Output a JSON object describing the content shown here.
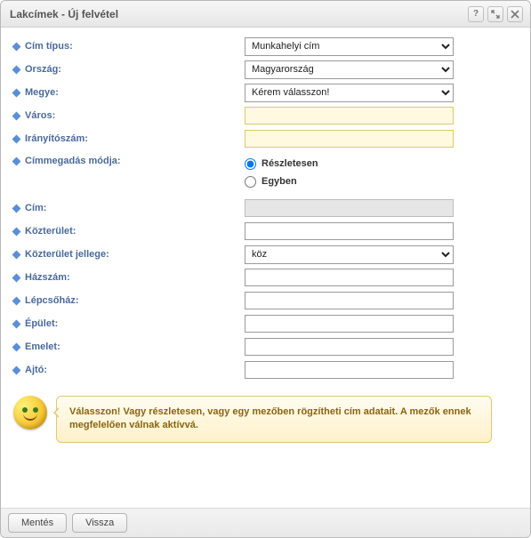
{
  "window": {
    "title": "Lakcímek - Új felvétel"
  },
  "labels": {
    "cimTipus": "Cím típus:",
    "orszag": "Ország:",
    "megye": "Megye:",
    "varos": "Város:",
    "iranyitoszam": "Irányítószám:",
    "cimmegadas": "Címmegadás módja:",
    "cim": "Cím:",
    "kozterulet": "Közterület:",
    "kozteruletJelleg": "Közterület jellege:",
    "hazszam": "Házszám:",
    "lepcsohaz": "Lépcsőház:",
    "epulet": "Épület:",
    "emelet": "Emelet:",
    "ajto": "Ajtó:"
  },
  "values": {
    "cimTipus": "Munkahelyi cím",
    "orszag": "Magyarország",
    "megye": "Kérem válasszon!",
    "varos": "",
    "iranyitoszam": "",
    "cim": "",
    "kozterulet": "",
    "kozteruletJelleg": "köz",
    "hazszam": "",
    "lepcsohaz": "",
    "epulet": "",
    "emelet": "",
    "ajto": ""
  },
  "radio": {
    "reszletesen": "Részletesen",
    "egyben": "Egyben",
    "selected": "reszletesen"
  },
  "hint": "Válasszon! Vagy részletesen, vagy egy mezőben rögzítheti cím adatait. A mezők ennek megfelelően válnak aktívvá.",
  "buttons": {
    "save": "Mentés",
    "back": "Vissza"
  }
}
